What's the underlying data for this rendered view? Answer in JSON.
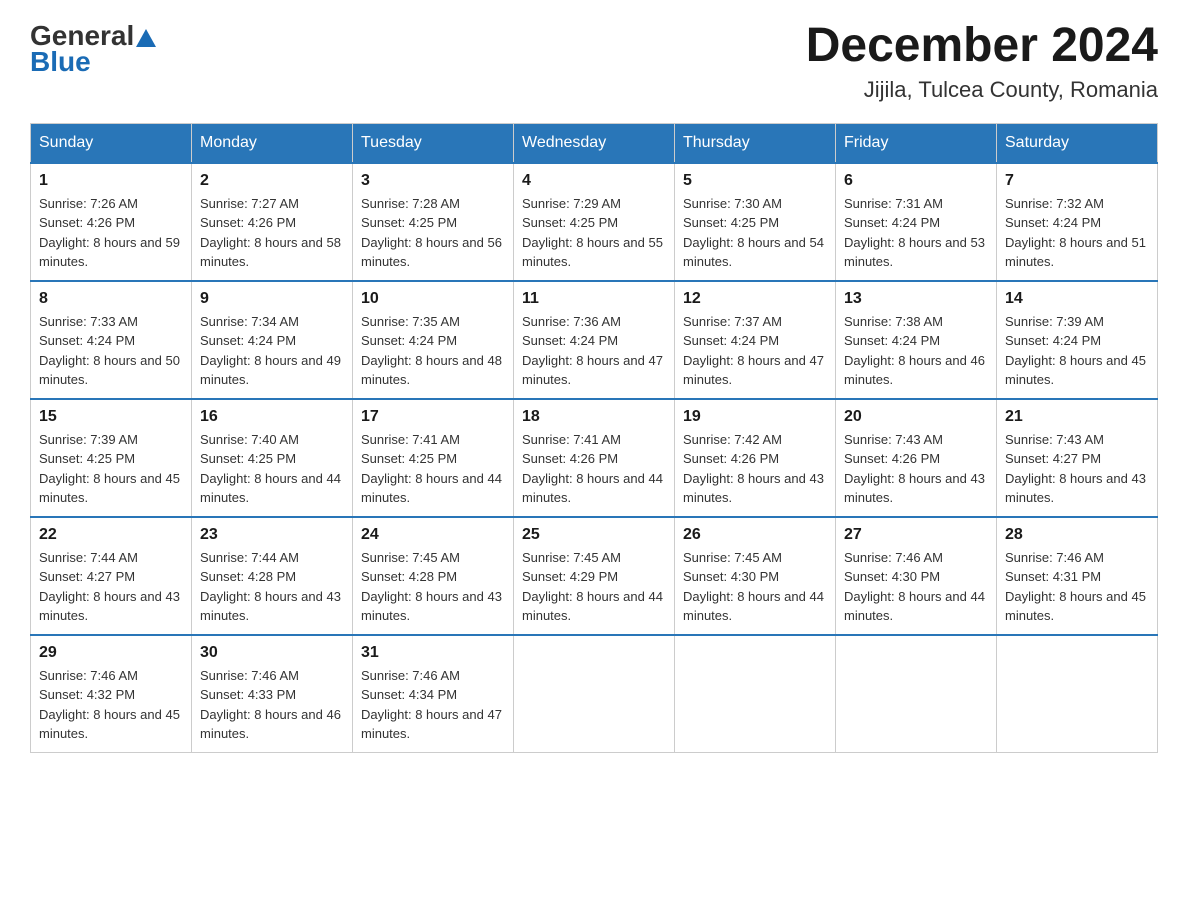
{
  "header": {
    "logo": {
      "text_general": "General",
      "text_blue": "Blue"
    },
    "title": "December 2024",
    "location": "Jijila, Tulcea County, Romania"
  },
  "calendar": {
    "weekdays": [
      "Sunday",
      "Monday",
      "Tuesday",
      "Wednesday",
      "Thursday",
      "Friday",
      "Saturday"
    ],
    "weeks": [
      [
        {
          "day": "1",
          "sunrise": "7:26 AM",
          "sunset": "4:26 PM",
          "daylight": "8 hours and 59 minutes."
        },
        {
          "day": "2",
          "sunrise": "7:27 AM",
          "sunset": "4:26 PM",
          "daylight": "8 hours and 58 minutes."
        },
        {
          "day": "3",
          "sunrise": "7:28 AM",
          "sunset": "4:25 PM",
          "daylight": "8 hours and 56 minutes."
        },
        {
          "day": "4",
          "sunrise": "7:29 AM",
          "sunset": "4:25 PM",
          "daylight": "8 hours and 55 minutes."
        },
        {
          "day": "5",
          "sunrise": "7:30 AM",
          "sunset": "4:25 PM",
          "daylight": "8 hours and 54 minutes."
        },
        {
          "day": "6",
          "sunrise": "7:31 AM",
          "sunset": "4:24 PM",
          "daylight": "8 hours and 53 minutes."
        },
        {
          "day": "7",
          "sunrise": "7:32 AM",
          "sunset": "4:24 PM",
          "daylight": "8 hours and 51 minutes."
        }
      ],
      [
        {
          "day": "8",
          "sunrise": "7:33 AM",
          "sunset": "4:24 PM",
          "daylight": "8 hours and 50 minutes."
        },
        {
          "day": "9",
          "sunrise": "7:34 AM",
          "sunset": "4:24 PM",
          "daylight": "8 hours and 49 minutes."
        },
        {
          "day": "10",
          "sunrise": "7:35 AM",
          "sunset": "4:24 PM",
          "daylight": "8 hours and 48 minutes."
        },
        {
          "day": "11",
          "sunrise": "7:36 AM",
          "sunset": "4:24 PM",
          "daylight": "8 hours and 47 minutes."
        },
        {
          "day": "12",
          "sunrise": "7:37 AM",
          "sunset": "4:24 PM",
          "daylight": "8 hours and 47 minutes."
        },
        {
          "day": "13",
          "sunrise": "7:38 AM",
          "sunset": "4:24 PM",
          "daylight": "8 hours and 46 minutes."
        },
        {
          "day": "14",
          "sunrise": "7:39 AM",
          "sunset": "4:24 PM",
          "daylight": "8 hours and 45 minutes."
        }
      ],
      [
        {
          "day": "15",
          "sunrise": "7:39 AM",
          "sunset": "4:25 PM",
          "daylight": "8 hours and 45 minutes."
        },
        {
          "day": "16",
          "sunrise": "7:40 AM",
          "sunset": "4:25 PM",
          "daylight": "8 hours and 44 minutes."
        },
        {
          "day": "17",
          "sunrise": "7:41 AM",
          "sunset": "4:25 PM",
          "daylight": "8 hours and 44 minutes."
        },
        {
          "day": "18",
          "sunrise": "7:41 AM",
          "sunset": "4:26 PM",
          "daylight": "8 hours and 44 minutes."
        },
        {
          "day": "19",
          "sunrise": "7:42 AM",
          "sunset": "4:26 PM",
          "daylight": "8 hours and 43 minutes."
        },
        {
          "day": "20",
          "sunrise": "7:43 AM",
          "sunset": "4:26 PM",
          "daylight": "8 hours and 43 minutes."
        },
        {
          "day": "21",
          "sunrise": "7:43 AM",
          "sunset": "4:27 PM",
          "daylight": "8 hours and 43 minutes."
        }
      ],
      [
        {
          "day": "22",
          "sunrise": "7:44 AM",
          "sunset": "4:27 PM",
          "daylight": "8 hours and 43 minutes."
        },
        {
          "day": "23",
          "sunrise": "7:44 AM",
          "sunset": "4:28 PM",
          "daylight": "8 hours and 43 minutes."
        },
        {
          "day": "24",
          "sunrise": "7:45 AM",
          "sunset": "4:28 PM",
          "daylight": "8 hours and 43 minutes."
        },
        {
          "day": "25",
          "sunrise": "7:45 AM",
          "sunset": "4:29 PM",
          "daylight": "8 hours and 44 minutes."
        },
        {
          "day": "26",
          "sunrise": "7:45 AM",
          "sunset": "4:30 PM",
          "daylight": "8 hours and 44 minutes."
        },
        {
          "day": "27",
          "sunrise": "7:46 AM",
          "sunset": "4:30 PM",
          "daylight": "8 hours and 44 minutes."
        },
        {
          "day": "28",
          "sunrise": "7:46 AM",
          "sunset": "4:31 PM",
          "daylight": "8 hours and 45 minutes."
        }
      ],
      [
        {
          "day": "29",
          "sunrise": "7:46 AM",
          "sunset": "4:32 PM",
          "daylight": "8 hours and 45 minutes."
        },
        {
          "day": "30",
          "sunrise": "7:46 AM",
          "sunset": "4:33 PM",
          "daylight": "8 hours and 46 minutes."
        },
        {
          "day": "31",
          "sunrise": "7:46 AM",
          "sunset": "4:34 PM",
          "daylight": "8 hours and 47 minutes."
        },
        null,
        null,
        null,
        null
      ]
    ]
  }
}
